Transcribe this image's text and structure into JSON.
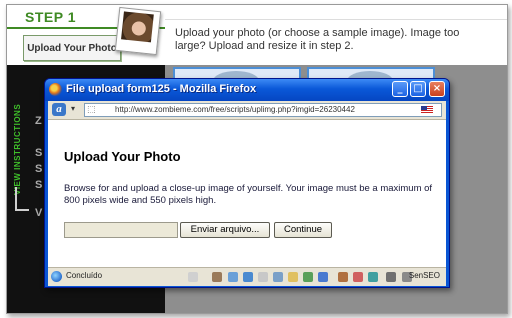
{
  "background_page": {
    "step_label": "STEP 1",
    "upload_button_label": "Upload Your Photo",
    "instructions": "Upload your photo (or choose a sample image). Image too large? Upload and resize it in step 2.",
    "view_instructions_label": "VIEW INSTRUCTIONS",
    "side_letters": [
      "Z",
      "S",
      "S",
      "S",
      "V"
    ]
  },
  "window": {
    "title": "File upload form125 - Mozilla Firefox",
    "controls": {
      "minimize": "_",
      "maximize": "□",
      "close": "×"
    }
  },
  "toolbar": {
    "url": "http://www.zombieme.com/free/scripts/uplimg.php?imgid=26230442"
  },
  "page": {
    "heading": "Upload Your Photo",
    "description": "Browse for and upload a close-up image of yourself. Your image must be a maximum of 800 pixels wide and 550 pixels high.",
    "file_input_value": "",
    "browse_button_label": "Enviar arquivo...",
    "continue_button_label": "Continue"
  },
  "statusbar": {
    "status_text": "Concluído",
    "addon_label": "SenSEO"
  },
  "colors": {
    "titlebar": "#0a58d8",
    "step_green": "#3f8a24",
    "background_gray": "#8e8e8e"
  }
}
